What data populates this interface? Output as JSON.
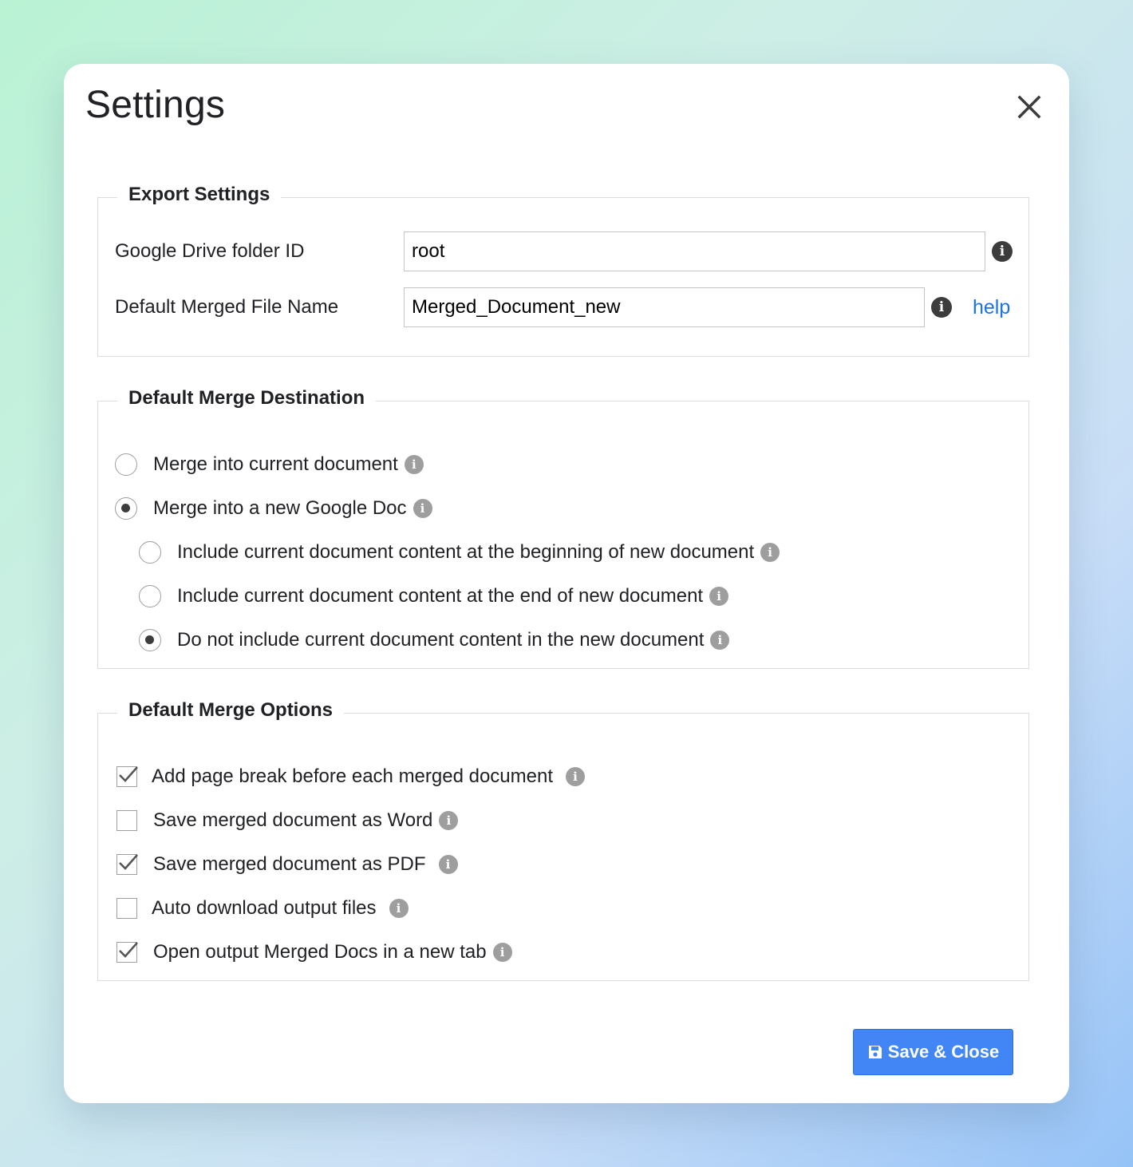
{
  "dialog": {
    "title": "Settings",
    "close_icon": "close-icon"
  },
  "export_settings": {
    "legend": "Export Settings",
    "folder_label": "Google Drive folder ID",
    "folder_value": "root",
    "filename_label": "Default Merged File Name",
    "filename_value": "Merged_Document_new",
    "help_label": "help",
    "info_icon": "info-icon"
  },
  "merge_destination": {
    "legend": "Default Merge Destination",
    "options": [
      {
        "label": "Merge into current document",
        "checked": false
      },
      {
        "label": "Merge into a new Google Doc",
        "checked": true
      }
    ],
    "sub_options": [
      {
        "label": "Include current document content at the beginning of new document",
        "checked": false
      },
      {
        "label": "Include current document content at the end of new document",
        "checked": false
      },
      {
        "label": "Do not include current document content in the new document",
        "checked": true
      }
    ]
  },
  "merge_options": {
    "legend": "Default Merge Options",
    "options": [
      {
        "label": "Add page break before each merged document",
        "checked": true
      },
      {
        "label": "Save merged document as Word",
        "checked": false
      },
      {
        "label": "Save merged document as PDF",
        "checked": true
      },
      {
        "label": "Auto download output files",
        "checked": false
      },
      {
        "label": "Open output Merged Docs in a new tab",
        "checked": true
      }
    ]
  },
  "footer": {
    "save_label": "Save & Close",
    "save_icon": "floppy-disk-icon"
  },
  "colors": {
    "accent": "#4285f4",
    "link": "#1a73e8"
  }
}
